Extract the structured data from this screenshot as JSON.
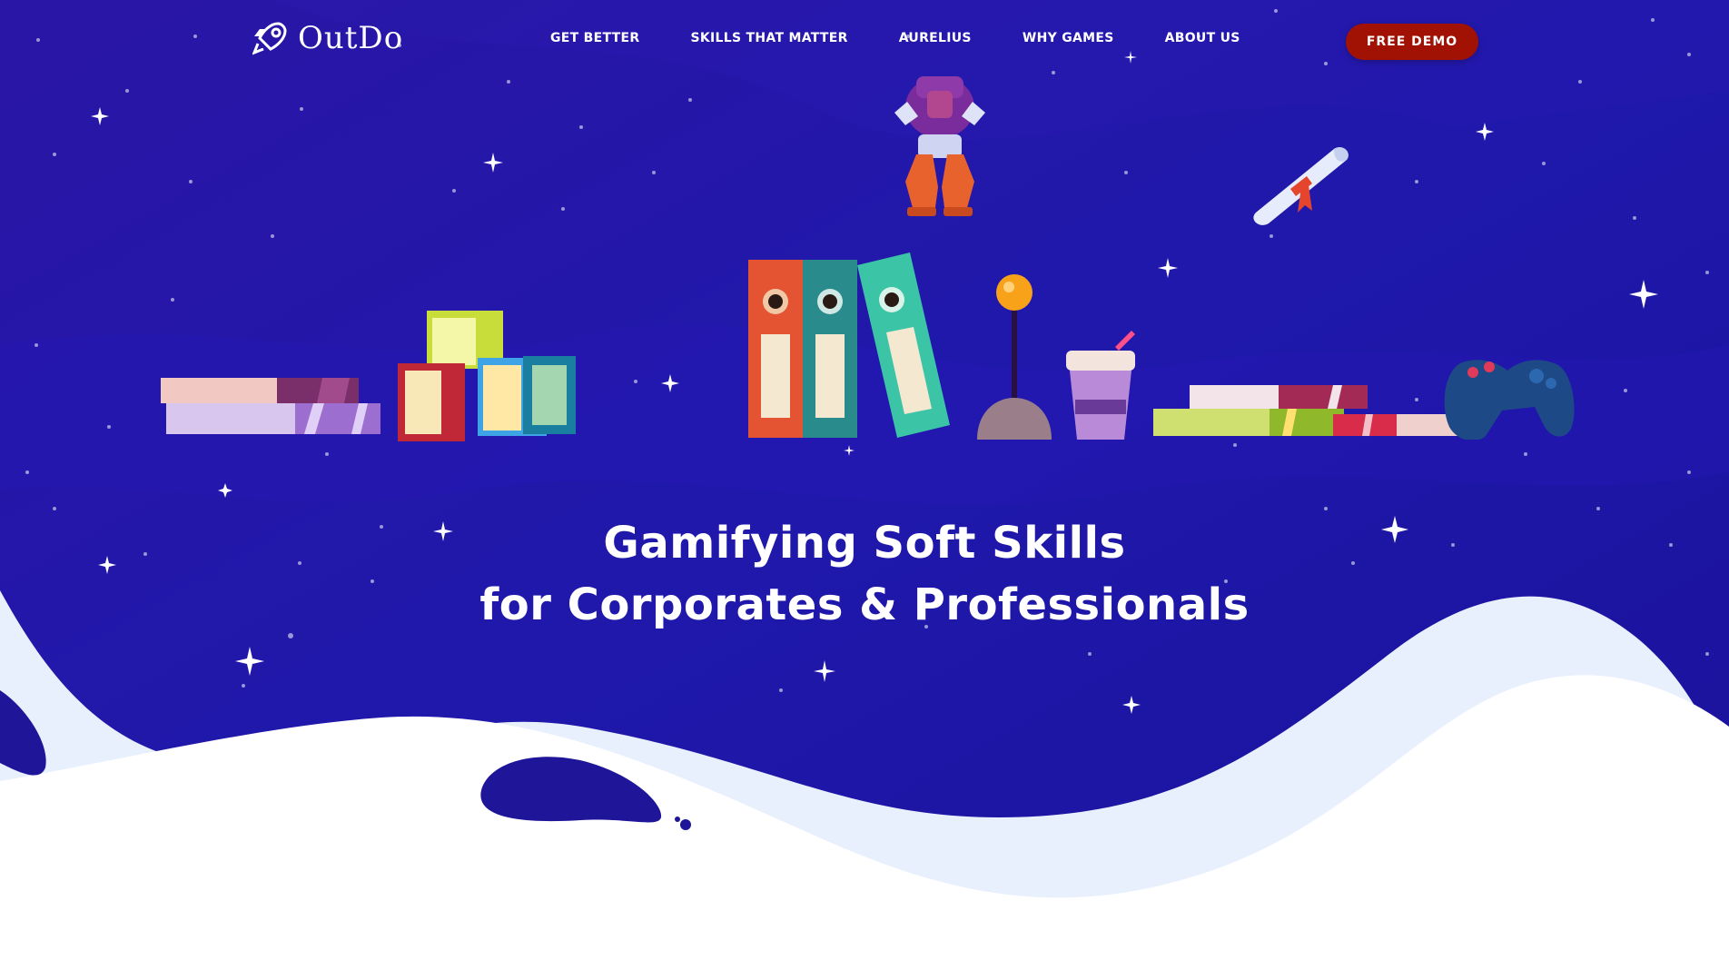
{
  "colors": {
    "space_top": "#1b169f",
    "space_mid": "#2016a8",
    "space_dark": "#160f8c",
    "cta_background": "#a11205",
    "wave_light": "#e9f0fd",
    "text": "#ffffff"
  },
  "brand": {
    "name": "OutDo",
    "logo_icon": "rocket-icon"
  },
  "nav": {
    "items": [
      {
        "label": "GET BETTER"
      },
      {
        "label": "SKILLS THAT MATTER"
      },
      {
        "label": "AURELIUS"
      },
      {
        "label": "WHY GAMES"
      },
      {
        "label": "ABOUT US"
      }
    ],
    "cta_label": "FREE DEMO"
  },
  "hero": {
    "headline_line1": "Gamifying Soft Skills",
    "headline_line2": "for Corporates & Professionals",
    "illustrations": [
      "robot-icon",
      "diploma-scroll-icon",
      "book-stack-icon",
      "box-stack-icon",
      "binders-icon",
      "joystick-icon",
      "coffee-cup-icon",
      "book-stack-icon",
      "gamepad-icon"
    ]
  }
}
